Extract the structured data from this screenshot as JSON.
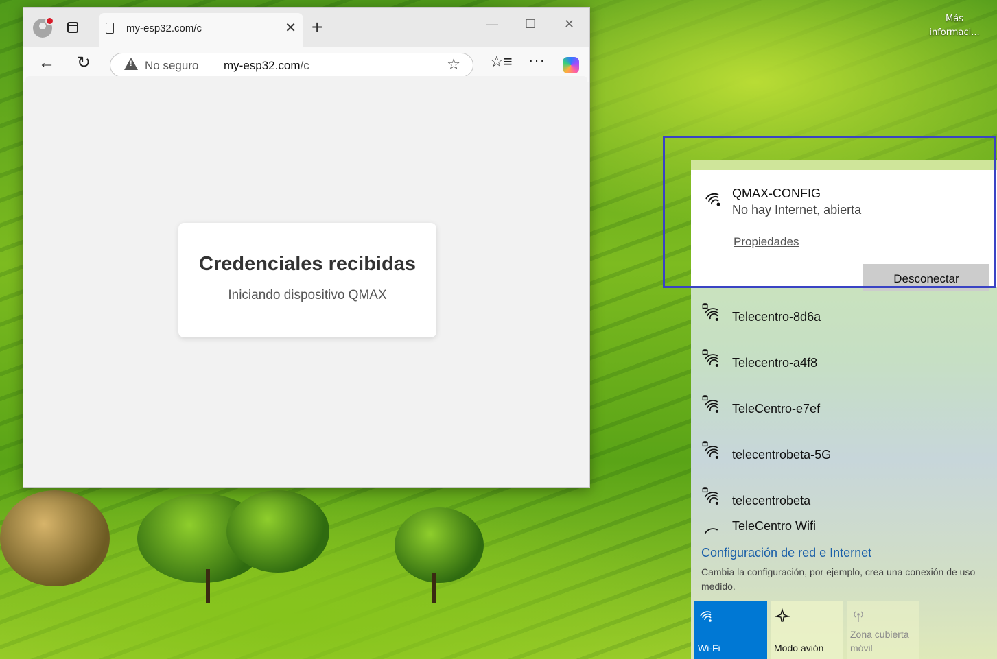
{
  "desktop": {
    "link_label": "Más informaci..."
  },
  "browser": {
    "tab_title": "my-esp32.com/c",
    "security_label": "No seguro",
    "url_host": "my-esp32.com",
    "url_path": "/c"
  },
  "page": {
    "title": "Credenciales recibidas",
    "subtitle": "Iniciando dispositivo QMAX"
  },
  "network": {
    "active": {
      "ssid": "QMAX-CONFIG",
      "status": "No hay Internet, abierta",
      "properties_label": "Propiedades",
      "disconnect_label": "Desconectar"
    },
    "available": [
      {
        "ssid": "Telecentro-8d6a",
        "secured": true
      },
      {
        "ssid": "Telecentro-a4f8",
        "secured": true
      },
      {
        "ssid": "TeleCentro-e7ef",
        "secured": true
      },
      {
        "ssid": "telecentrobeta-5G",
        "secured": true
      },
      {
        "ssid": "telecentrobeta",
        "secured": true
      },
      {
        "ssid": "TeleCentro Wifi",
        "secured": true
      }
    ],
    "settings_title": "Configuración de red e Internet",
    "settings_desc": "Cambia la configuración, por ejemplo, crea una conexión de uso medido.",
    "quick_actions": [
      {
        "label": "Wi-Fi",
        "active": true,
        "icon": "wifi-icon"
      },
      {
        "label": "Modo avión",
        "active": false,
        "icon": "airplane-icon"
      },
      {
        "label": "Zona cubierta móvil",
        "active": false,
        "disabled": true,
        "icon": "hotspot-icon"
      }
    ]
  },
  "colors": {
    "accent": "#0078d4",
    "highlight_border": "#3a43c4",
    "link": "#1a5fa8"
  }
}
